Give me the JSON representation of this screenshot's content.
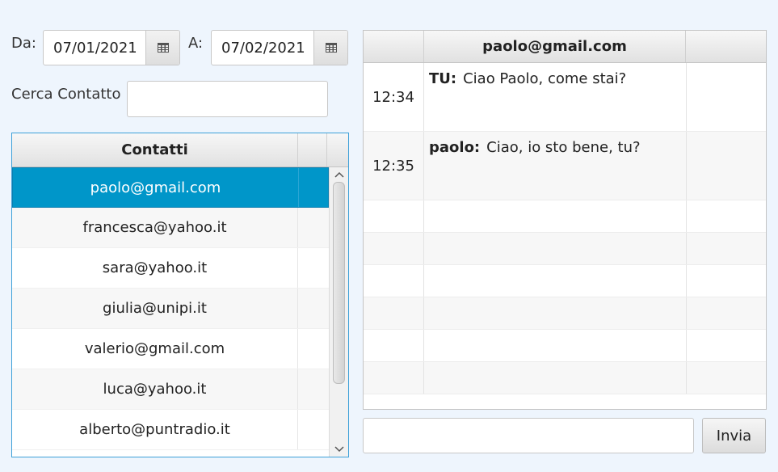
{
  "filters": {
    "from_label": "Da:",
    "from_date": "07/01/2021",
    "to_label": "A:",
    "to_date": "07/02/2021",
    "search_label": "Cerca Contatto",
    "search_value": ""
  },
  "contacts": {
    "header": "Contatti",
    "items": [
      "paolo@gmail.com",
      "francesca@yahoo.it",
      "sara@yahoo.it",
      "giulia@unipi.it",
      "valerio@gmail.com",
      "luca@yahoo.it",
      "alberto@puntradio.it"
    ],
    "selected_index": 0
  },
  "chat": {
    "header": "paolo@gmail.com",
    "messages": [
      {
        "time": "12:34",
        "sender": "TU:",
        "text": "Ciao Paolo, come stai?"
      },
      {
        "time": "12:35",
        "sender": "paolo:",
        "text": "Ciao, io sto bene, tu?"
      }
    ],
    "empty_rows": 6
  },
  "composer": {
    "value": "",
    "send_label": "Invia"
  },
  "colors": {
    "background": "#eef5fd",
    "selection": "#0096c9",
    "focus_border": "#3ea0d8"
  },
  "icons": {
    "date_picker": "calendar-icon",
    "scroll_up": "chevron-up-icon",
    "scroll_down": "chevron-down-icon"
  }
}
